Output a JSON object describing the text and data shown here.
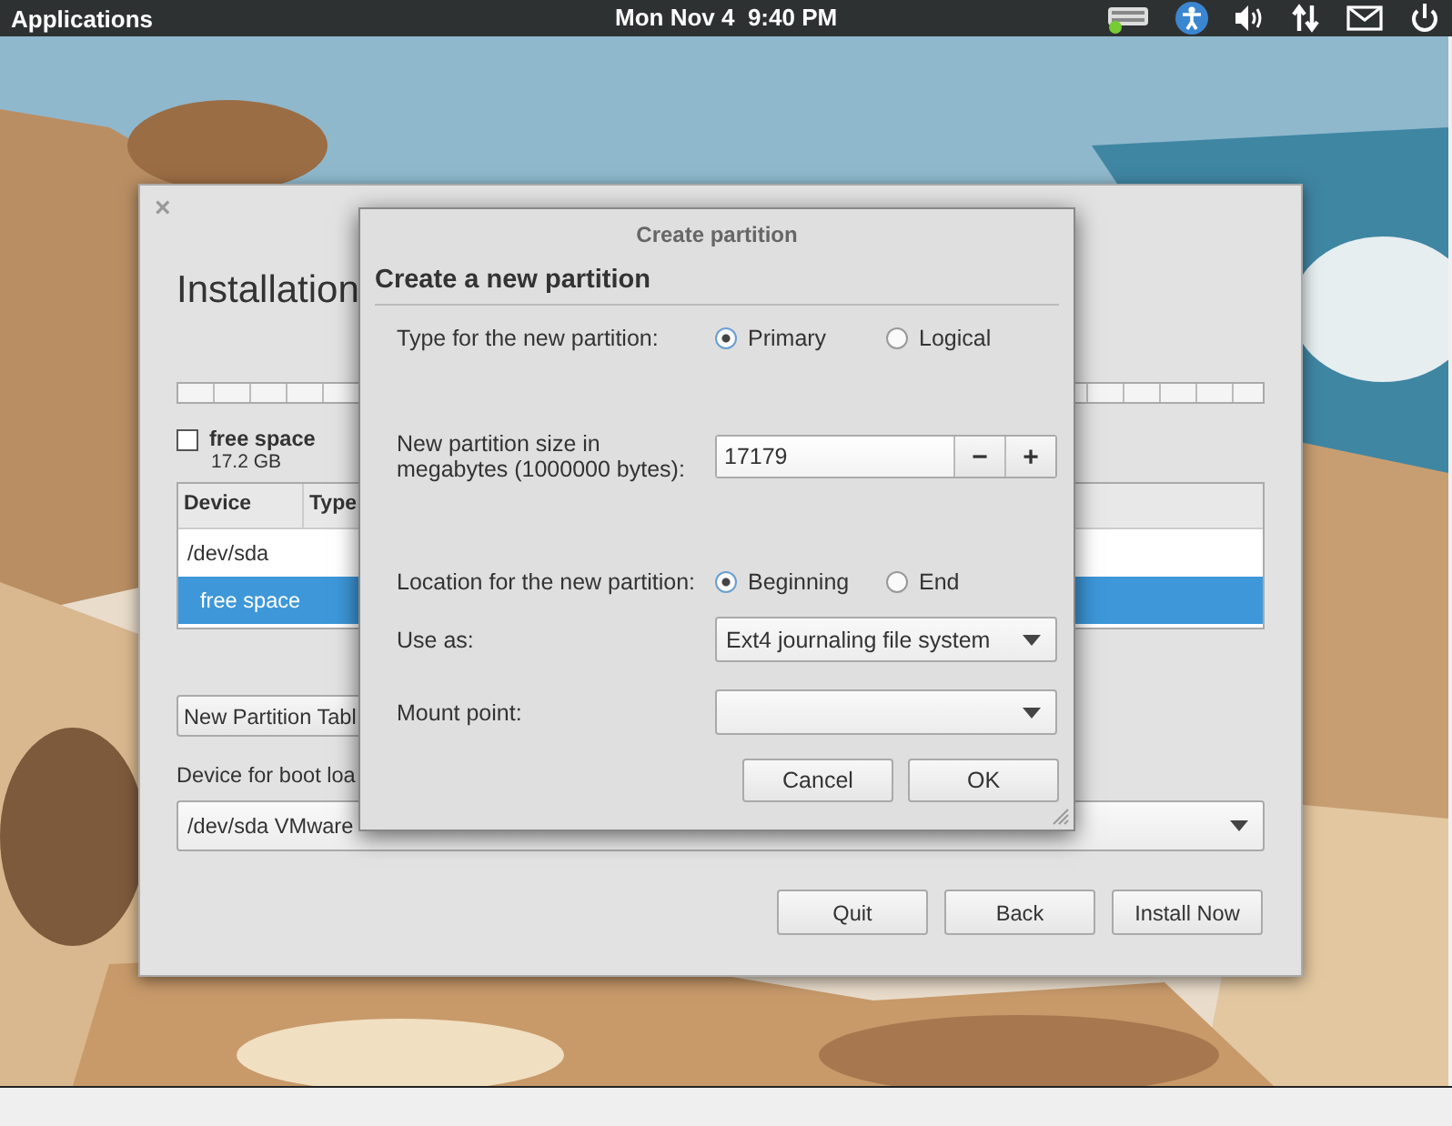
{
  "top_panel": {
    "menu": "Applications",
    "clock": "Mon Nov 4  9:40 PM"
  },
  "installer_window": {
    "close": "×",
    "heading": "Installation",
    "partitions": [
      {
        "label": "free space",
        "size": "17.2 GB",
        "checked": false
      }
    ],
    "table": {
      "columns": [
        "Device",
        "Type"
      ],
      "rows": [
        {
          "device": "/dev/sda",
          "selected": false,
          "children": [
            {
              "device": "free space",
              "selected": true
            }
          ]
        }
      ]
    },
    "new_partition_table_button": "New Partition Tabl",
    "boot_loader_label": "Device for boot loa",
    "boot_loader_device": "/dev/sda  VMware",
    "buttons": [
      "Quit",
      "Back",
      "Install Now"
    ]
  },
  "dialog": {
    "title": "Create partition",
    "heading": "Create a new partition",
    "type": {
      "label": "Type for the new partition:",
      "options": [
        {
          "label": "Primary",
          "selected": true
        },
        {
          "label": "Logical",
          "selected": false
        }
      ]
    },
    "size": {
      "label": "New partition size in megabytes (1000000 bytes):",
      "value": "17179",
      "decrement": "−",
      "increment": "+"
    },
    "location": {
      "label": "Location for the new partition:",
      "options": [
        {
          "label": "Beginning",
          "selected": true
        },
        {
          "label": "End",
          "selected": false
        }
      ]
    },
    "use_as": {
      "label": "Use as:",
      "value": "Ext4 journaling file system"
    },
    "mount_point": {
      "label": "Mount point:"
    },
    "buttons": [
      "Cancel",
      "OK"
    ]
  }
}
